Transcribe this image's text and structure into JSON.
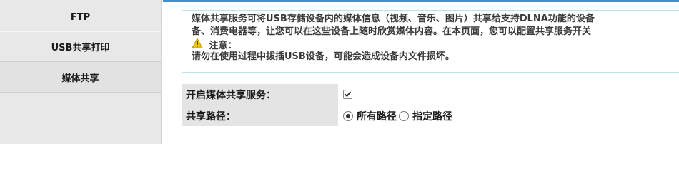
{
  "sidebar": {
    "items": [
      {
        "label": "FTP"
      },
      {
        "label": "USB共享打印"
      },
      {
        "label": "媒体共享"
      }
    ]
  },
  "notice": {
    "line1": "媒体共享服务可将USB存储设备内的媒体信息（视频、音乐、图片）共享给支持DLNA功能的设备",
    "line2": "备、消费电器等，让您可以在这些设备上随时欣赏媒体内容。在本页面，您可以配置共享服务开关",
    "warning_title": "注意：",
    "warning_text": "请勿在使用过程中拔插USB设备，可能会造成设备内文件损坏。"
  },
  "form": {
    "enable_label": "开启媒体共享服务：",
    "enable_checked": true,
    "path_label": "共享路径：",
    "path_options": [
      {
        "label": "所有路径",
        "selected": true
      },
      {
        "label": "指定路径",
        "selected": false
      }
    ]
  },
  "colors": {
    "accent": "#3d8fcf",
    "sidebar_bg": "#e8e8e8",
    "warning": "#f0c419"
  }
}
